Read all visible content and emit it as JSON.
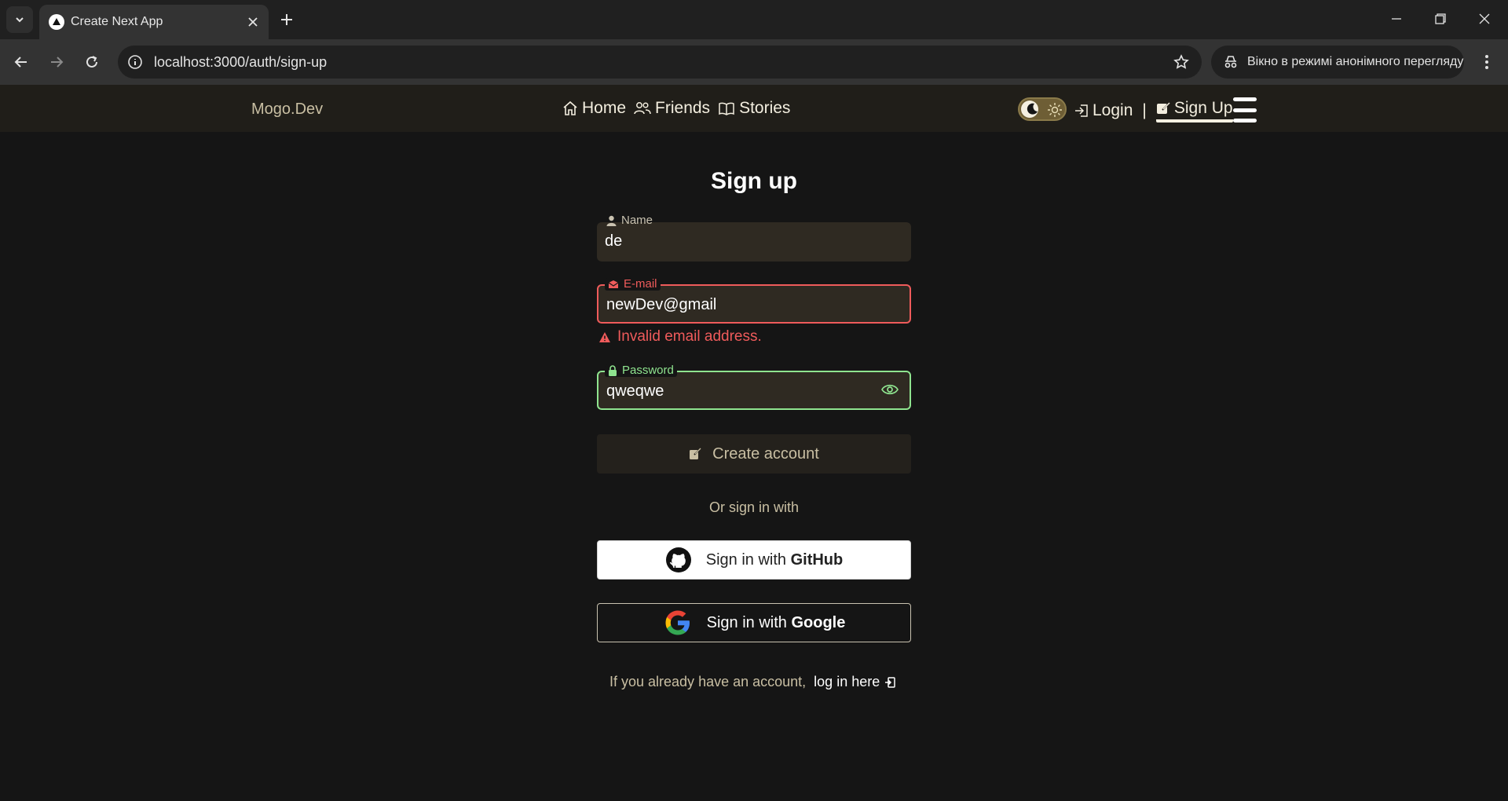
{
  "browser": {
    "tab_title": "Create Next App",
    "url": "localhost:3000/auth/sign-up",
    "incognito_label": "Вікно в режимі анонімного перегляду"
  },
  "header": {
    "brand": "Mogo.Dev",
    "nav": [
      {
        "label": "Home",
        "icon": "home-icon"
      },
      {
        "label": "Friends",
        "icon": "friends-icon"
      },
      {
        "label": "Stories",
        "icon": "book-icon"
      }
    ],
    "login_label": "Login",
    "separator": "|",
    "signup_label": "Sign Up"
  },
  "form": {
    "title": "Sign up",
    "name": {
      "label": "Name",
      "value": "de"
    },
    "email": {
      "label": "E-mail",
      "value": "newDev@gmail",
      "error": "Invalid email address."
    },
    "password": {
      "label": "Password",
      "value": "qweqwe"
    },
    "submit_label": "Create account",
    "or_text": "Or sign in with",
    "github": {
      "prefix": "Sign in with",
      "provider": "GitHub"
    },
    "google": {
      "prefix": "Sign in with",
      "provider": "Google"
    },
    "footer_text": "If you already have an account,",
    "login_link": "log in here"
  },
  "colors": {
    "page_bg": "#151515",
    "header_bg": "#201e19",
    "error": "#ef5b5b",
    "success": "#8fe48f",
    "accent_gold": "#c9bfa3"
  }
}
